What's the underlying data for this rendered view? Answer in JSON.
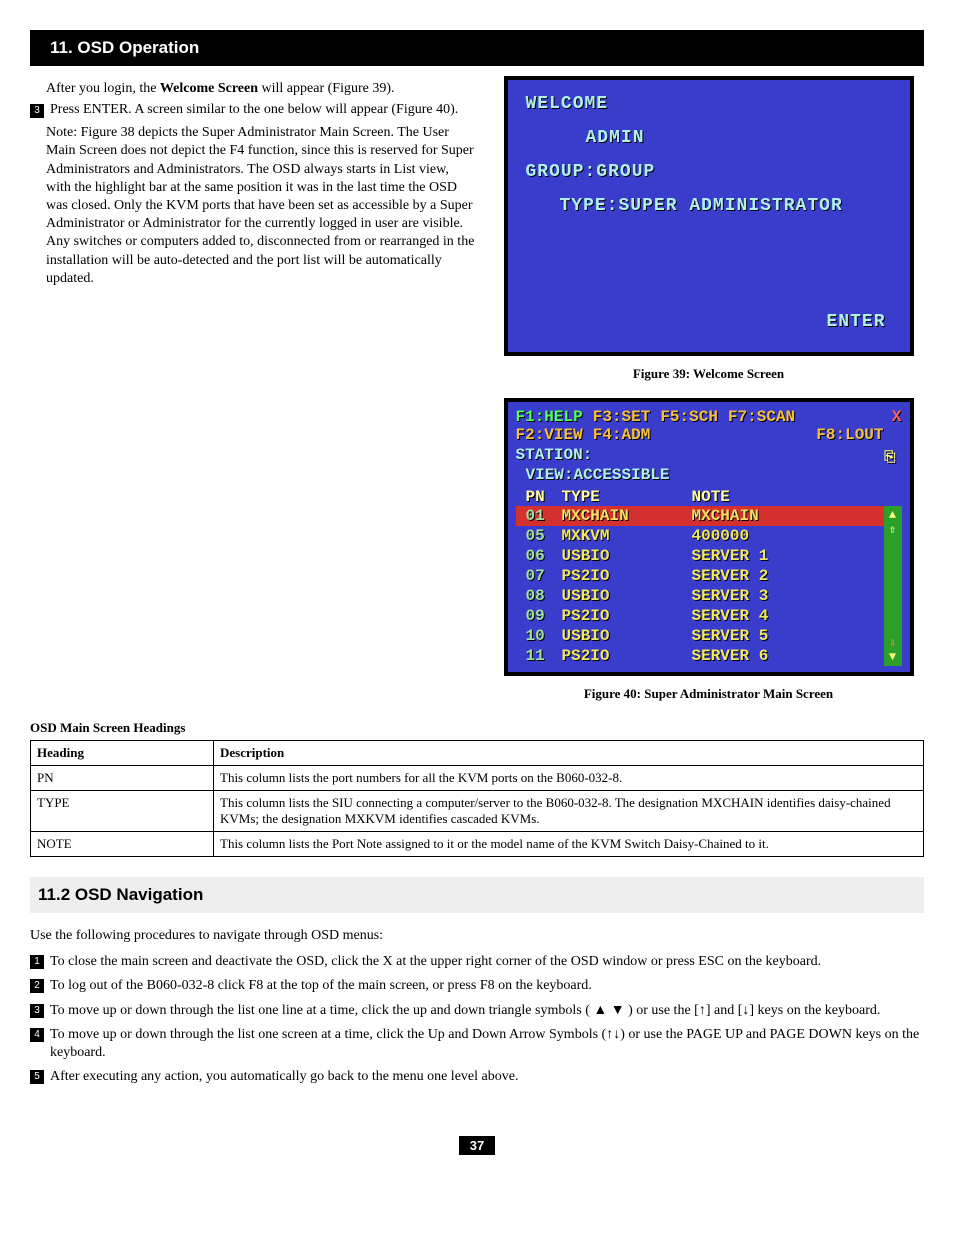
{
  "section_title": "11. OSD Operation",
  "intro_before": "After you login, the ",
  "intro_bold": "Welcome Screen",
  "intro_after": " will appear (Figure 39).",
  "step3_num": "3",
  "step3_text": "Press ENTER. A screen similar to the one below will appear (Figure 40).",
  "note_text": "Note: Figure 38 depicts the Super Administrator Main Screen. The User Main Screen does not depict the F4 function, since this is reserved for Super Administrators and Administrators. The OSD always starts in List view, with the highlight bar at the same position it was in the last time the OSD was closed. Only the KVM ports that have been set as accessible by a Super Administrator or Administrator for the currently logged in user are visible. Any switches or computers added to, disconnected from or rearranged in the installation will be auto-detected and the port list will be automatically updated.",
  "welcome": {
    "title": "WELCOME",
    "user": "ADMIN",
    "group": "GROUP:GROUP",
    "type": "TYPE:SUPER ADMINISTRATOR",
    "enter": "ENTER"
  },
  "fig39_caption": "Figure 39: Welcome Screen",
  "main_osd": {
    "f1": "F1:HELP",
    "f2": "F2:VIEW",
    "f3": "F3:SET",
    "f4": "F4:ADM",
    "f5": "F5:SCH",
    "f7": "F7:SCAN",
    "f8": "F8:LOUT",
    "close": "X",
    "station": "STATION:",
    "view": "VIEW:ACCESSIBLE",
    "hdr_pn": "PN",
    "hdr_type": "TYPE",
    "hdr_note": "NOTE",
    "rows": [
      {
        "pn": "01",
        "type": "MXCHAIN",
        "note": "MXCHAIN",
        "hl": true
      },
      {
        "pn": "05",
        "type": "MXKVM",
        "note": "400000"
      },
      {
        "pn": "06",
        "type": "USBIO",
        "note": "SERVER 1"
      },
      {
        "pn": "07",
        "type": "PS2IO",
        "note": "SERVER 2"
      },
      {
        "pn": "08",
        "type": "USBIO",
        "note": "SERVER 3"
      },
      {
        "pn": "09",
        "type": "PS2IO",
        "note": "SERVER 4"
      },
      {
        "pn": "10",
        "type": "USBIO",
        "note": "SERVER 5"
      },
      {
        "pn": "11",
        "type": "PS2IO",
        "note": "SERVER 6"
      }
    ]
  },
  "fig40_caption": "Figure 40: Super Administrator Main Screen",
  "headings_title": "OSD Main Screen Headings",
  "table": {
    "h1": "Heading",
    "h2": "Description",
    "rows": [
      {
        "h": "PN",
        "d": "This column lists the port numbers for all the KVM ports on the B060-032-8."
      },
      {
        "h": "TYPE",
        "d": "This column lists the SIU connecting a computer/server to the B060-032-8. The designation MXCHAIN identifies daisy-chained KVMs; the designation MXKVM identifies cascaded KVMs."
      },
      {
        "h": "NOTE",
        "d": "This column lists the Port Note assigned to it or the model name of the KVM Switch Daisy-Chained to it."
      }
    ]
  },
  "subsection_title": "11.2 OSD Navigation",
  "nav_intro": "Use the following procedures to navigate through OSD menus:",
  "nav_items": [
    {
      "n": "1",
      "t": "To close the main screen and deactivate the OSD, click the X at the upper right corner of the OSD window or press ESC on the keyboard."
    },
    {
      "n": "2",
      "t": "To log out of the B060-032-8 click F8 at the top of the main screen, or press F8 on the keyboard."
    },
    {
      "n": "3",
      "t": "To move up or down through the list one line at a time, click the up and down triangle symbols ( ▲ ▼ ) or use the [↑] and [↓] keys on the keyboard."
    },
    {
      "n": "4",
      "t": "To move up or down through the list one screen at a time, click the Up and Down Arrow Symbols (↑↓) or use the PAGE UP and PAGE DOWN keys on the keyboard."
    },
    {
      "n": "5",
      "t": "After executing any action, you automatically go back to the menu one level above."
    }
  ],
  "page_number": "37"
}
